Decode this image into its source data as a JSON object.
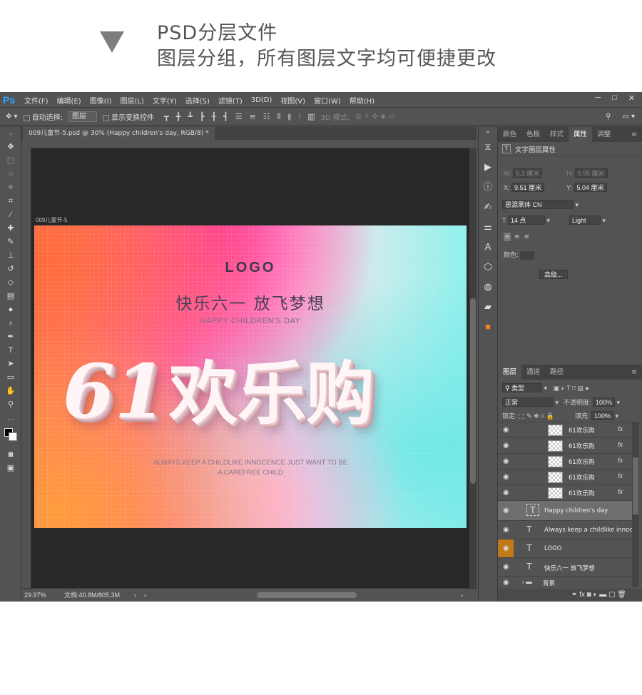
{
  "header": {
    "line1": "PSD分层文件",
    "line2": "图层分组，所有图层文字均可便捷更改"
  },
  "app": {
    "logo": "Ps",
    "menus": [
      "文件(F)",
      "编辑(E)",
      "图像(I)",
      "图层(L)",
      "文字(Y)",
      "选择(S)",
      "滤镜(T)",
      "3D(D)",
      "视图(V)",
      "窗口(W)",
      "帮助(H)"
    ],
    "window_buttons": [
      "─",
      "□",
      "✕"
    ]
  },
  "options": {
    "auto_select_label": "自动选择:",
    "auto_select_value": "图层",
    "show_transform_label": "显示变换控件",
    "mode_3d_label": "3D 模式:"
  },
  "document": {
    "tab_title": "009儿童节-5.psd @ 30% (Happy children's day, RGB/8) *",
    "artboard_label": "009儿童节-5",
    "zoom": "29.97%",
    "doc_info": "文档:40.8M/805.3M"
  },
  "artwork": {
    "logo": "LOGO",
    "slogan": "快乐六一  放飞梦想",
    "subtitle": "HAPPY CHILDREN'S DAY",
    "big_number": "61",
    "big_text": "欢乐购",
    "tagline_line1": "ALWAYS KEEP A CHILDLIKE INNOCENCE JUST WANT TO BE",
    "tagline_line2": "A CAREFREE CHILD"
  },
  "properties_panel": {
    "tabs": [
      "颜色",
      "色板",
      "样式",
      "属性",
      "调整"
    ],
    "active_tab": "属性",
    "title": "文字图层属性",
    "w_label": "W:",
    "w_value": "5.3 厘米",
    "h_label": "H:",
    "h_value": "0.95 厘米",
    "x_label": "X:",
    "x_value": "9.51 厘米",
    "y_label": "Y:",
    "y_value": "5.04 厘米",
    "font_family": "思源黑体 CN",
    "font_size": "14 点",
    "font_style": "Light",
    "color_label": "颜色:",
    "advanced_button": "高级..."
  },
  "layers_panel": {
    "tabs": [
      "图层",
      "通道",
      "路径"
    ],
    "active_tab": "图层",
    "filter_kind": "类型",
    "blend_mode": "正常",
    "opacity_label": "不透明度:",
    "opacity_value": "100%",
    "lock_label": "锁定:",
    "fill_label": "填充:",
    "fill_value": "100%",
    "layers": [
      {
        "name": "61欢乐购",
        "type": "image",
        "fx": "fx"
      },
      {
        "name": "61欢乐购",
        "type": "image",
        "fx": "fx"
      },
      {
        "name": "61欢乐购",
        "type": "image",
        "fx": "fx"
      },
      {
        "name": "61欢乐购",
        "type": "image",
        "fx": "fx"
      },
      {
        "name": "61欢乐购",
        "type": "image",
        "fx": "fx"
      },
      {
        "name": "Happy children's day",
        "type": "text",
        "selected": true
      },
      {
        "name": "Always keep a childlike innoc...",
        "type": "text"
      },
      {
        "name": "LOGO",
        "type": "text",
        "highlight_color": "#c07a1a"
      },
      {
        "name": "快乐六一  放飞梦想",
        "type": "text"
      },
      {
        "name": "背景",
        "type": "group"
      }
    ]
  },
  "colors": {
    "ps_accent": "#31a8ff",
    "ui_bg": "#535353",
    "canvas_bg": "#282828",
    "selected_layer": "#6e6e6e"
  }
}
